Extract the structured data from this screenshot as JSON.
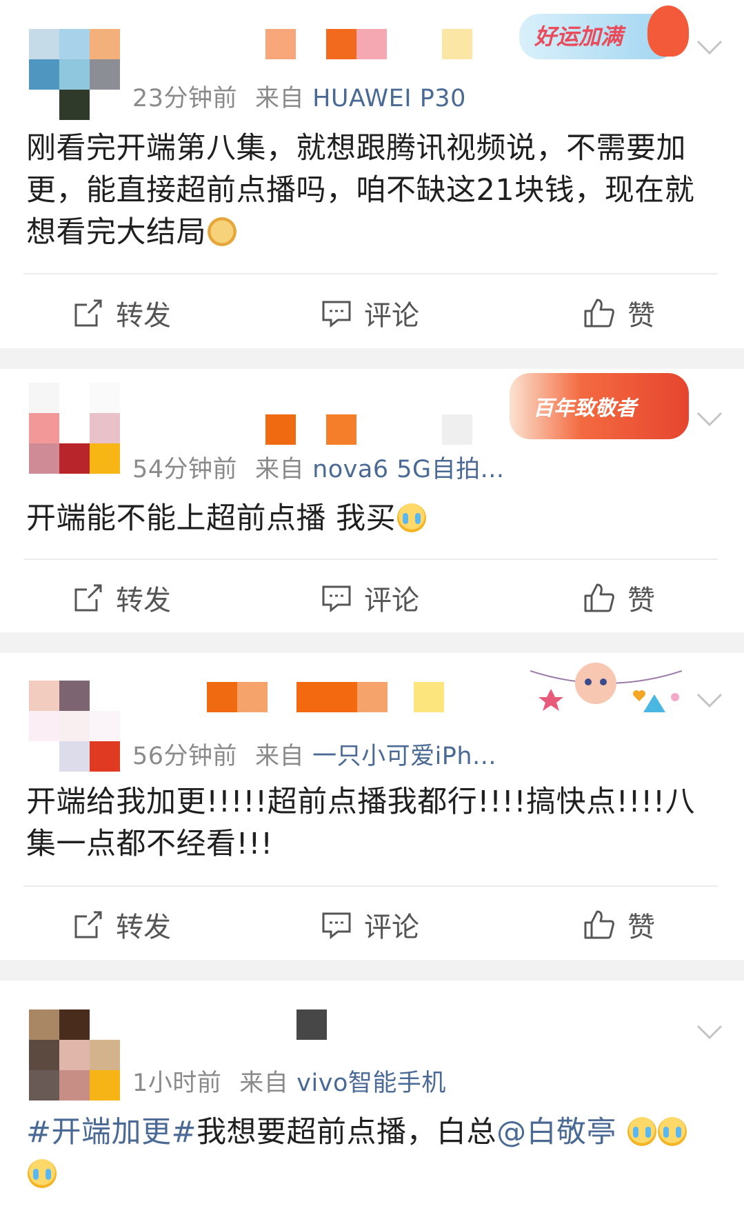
{
  "actions": {
    "repost": "转发",
    "comment": "评论",
    "like": "赞"
  },
  "posts": [
    {
      "time": "23分钟前",
      "source_label": "来自",
      "device": "HUAWEI P30",
      "text": "刚看完开端第八集，就想跟腾讯视频说，不需要加更，能直接超前点播吗，咱不缺这21块钱，现在就想看完大结局",
      "badge": "好运加满"
    },
    {
      "time": "54分钟前",
      "source_label": "来自",
      "device": "nova6 5G自拍...",
      "text": "开端能不能上超前点播 我买",
      "badge": "百年致敬者"
    },
    {
      "time": "56分钟前",
      "source_label": "来自",
      "device": "一只小可爱iPh...",
      "text": "开端给我加更!!!!!超前点播我都行!!!!搞快点!!!!八集一点都不经看!!!"
    },
    {
      "time": "1小时前",
      "source_label": "来自",
      "device": "vivo智能手机",
      "hashtag": "#开端加更#",
      "text": "我想要超前点播，白总",
      "mention": "@白敬亭"
    }
  ],
  "colors": {
    "link": "#4a6a95",
    "meta": "#8a8a8a",
    "divider": "#ececec"
  }
}
